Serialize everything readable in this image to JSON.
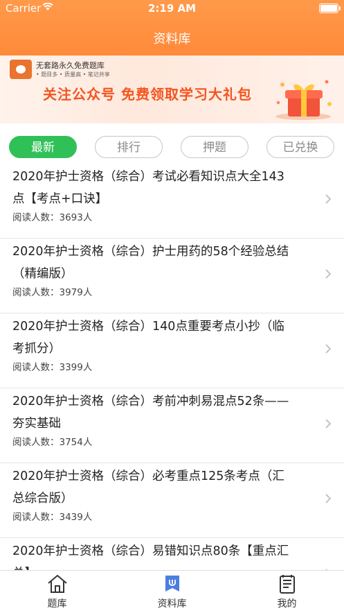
{
  "status_bar": {
    "carrier": "Carrier",
    "time": "2:19 AM"
  },
  "nav": {
    "title": "资料库"
  },
  "banner": {
    "brand": "无套路永久免费题库",
    "tags": "• 题目多    • 质量高    • 笔记共享",
    "slogan": "关注公众号 免费领取学习大礼包"
  },
  "tabs": [
    {
      "label": "最新",
      "active": true
    },
    {
      "label": "排行",
      "active": false
    },
    {
      "label": "押题",
      "active": false
    },
    {
      "label": "已兑换",
      "active": false
    }
  ],
  "items": [
    {
      "line1": "2020年护士资格（综合）考试必看知识点大全143",
      "line2": "点【考点+口诀】",
      "meta": "阅读人数：3693人"
    },
    {
      "line1": "2020年护士资格（综合）护士用药的58个经验总结",
      "line2": "（精编版）",
      "meta": "阅读人数：3979人"
    },
    {
      "line1": "2020年护士资格（综合）140点重要考点小抄（临",
      "line2": "考抓分）",
      "meta": "阅读人数：3399人"
    },
    {
      "line1": "2020年护士资格（综合）考前冲刺易混点52条——",
      "line2": "夯实基础",
      "meta": "阅读人数：3754人"
    },
    {
      "line1": "2020年护士资格（综合）必考重点125条考点（汇",
      "line2": "总综合版）",
      "meta": "阅读人数：3439人"
    },
    {
      "line1": "2020年护士资格（综合）易错知识点80条【重点汇",
      "line2": "总】",
      "meta": ""
    }
  ],
  "tabbar": [
    {
      "label": "题库",
      "icon": "home-icon"
    },
    {
      "label": "资料库",
      "icon": "library-icon"
    },
    {
      "label": "我的",
      "icon": "profile-icon"
    }
  ],
  "colors": {
    "header": "#ff8a3a",
    "active_tab": "#2fc157",
    "slogan": "#f4541e",
    "tabbar_active": "#4a7fe0"
  }
}
